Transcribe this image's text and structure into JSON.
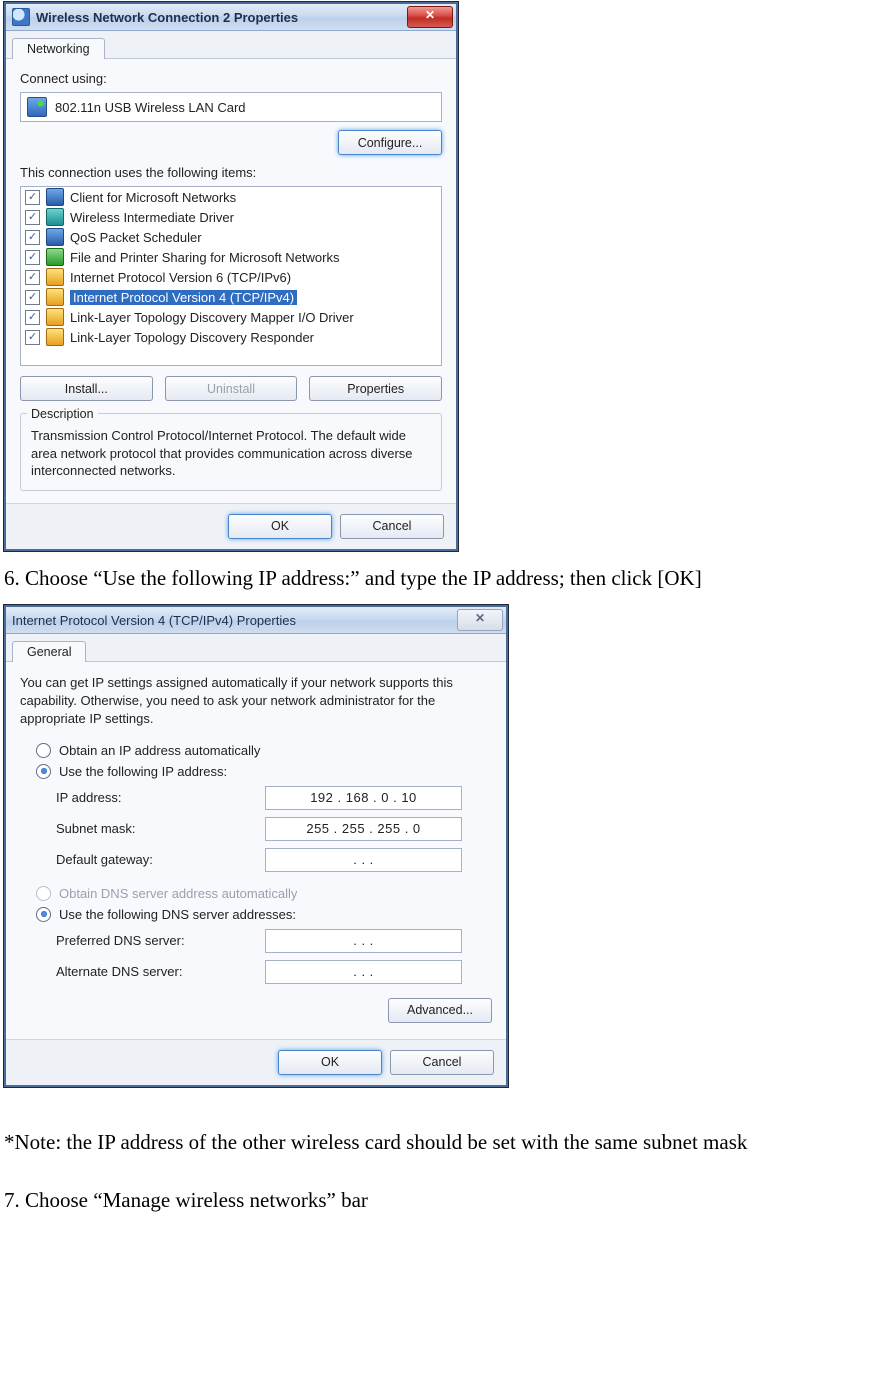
{
  "dialog1": {
    "title": "Wireless Network Connection 2 Properties",
    "tab": "Networking",
    "connect_label": "Connect using:",
    "adapter": "802.11n USB Wireless LAN Card",
    "configure_btn": "Configure...",
    "items_label": "This connection uses the following items:",
    "items": [
      {
        "label": "Client for Microsoft Networks",
        "icon": "ico-blue"
      },
      {
        "label": "Wireless Intermediate Driver",
        "icon": "ico-teal"
      },
      {
        "label": "QoS Packet Scheduler",
        "icon": "ico-blue"
      },
      {
        "label": "File and Printer Sharing for Microsoft Networks",
        "icon": "ico-green"
      },
      {
        "label": "Internet Protocol Version 6 (TCP/IPv6)",
        "icon": "ico-yellow"
      },
      {
        "label": "Internet Protocol Version 4 (TCP/IPv4)",
        "icon": "ico-yellow",
        "selected": true
      },
      {
        "label": "Link-Layer Topology Discovery Mapper I/O Driver",
        "icon": "ico-yellow"
      },
      {
        "label": "Link-Layer Topology Discovery Responder",
        "icon": "ico-yellow"
      }
    ],
    "install_btn": "Install...",
    "uninstall_btn": "Uninstall",
    "properties_btn": "Properties",
    "desc_legend": "Description",
    "desc_text": "Transmission Control Protocol/Internet Protocol. The default wide area network protocol that provides communication across diverse interconnected networks.",
    "ok_btn": "OK",
    "cancel_btn": "Cancel"
  },
  "step6": "6. Choose “Use the following IP address:” and type the IP address; then click [OK]",
  "dialog2": {
    "title": "Internet Protocol Version 4 (TCP/IPv4) Properties",
    "tab": "General",
    "desc": "You can get IP settings assigned automatically if your network supports this capability. Otherwise, you need to ask your network administrator for the appropriate IP settings.",
    "radio_auto_ip": "Obtain an IP address automatically",
    "radio_manual_ip": "Use the following IP address:",
    "ip_label": "IP address:",
    "ip_value": "192 . 168 .  0  .  10",
    "mask_label": "Subnet mask:",
    "mask_value": "255 . 255 . 255 .  0",
    "gw_label": "Default gateway:",
    "gw_value": ".       .       .",
    "radio_auto_dns": "Obtain DNS server address automatically",
    "radio_manual_dns": "Use the following DNS server addresses:",
    "pdns_label": "Preferred DNS server:",
    "pdns_value": ".       .       .",
    "adns_label": "Alternate DNS server:",
    "adns_value": ".       .       .",
    "advanced_btn": "Advanced...",
    "ok_btn": "OK",
    "cancel_btn": "Cancel"
  },
  "note": "*Note: the IP address of the other wireless card should be set with the same subnet mask",
  "step7": "7. Choose “Manage wireless networks” bar"
}
